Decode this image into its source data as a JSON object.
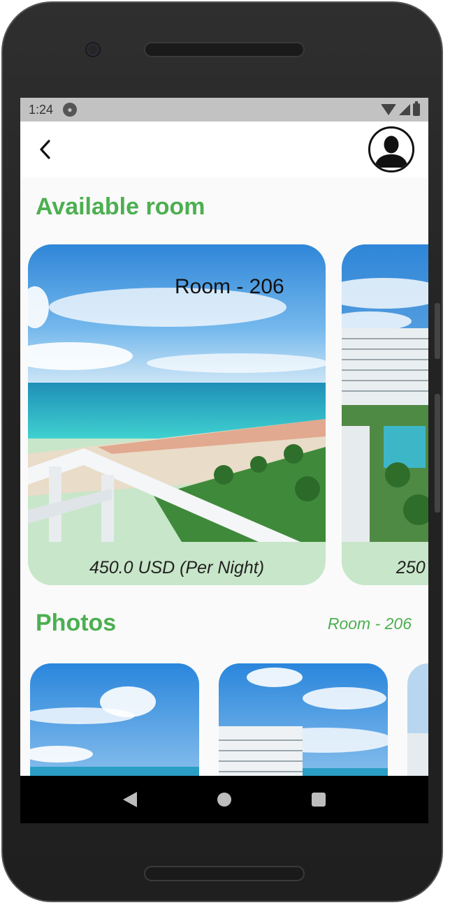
{
  "status_bar": {
    "time": "1:24"
  },
  "header": {
    "back_icon": "chevron-left-icon",
    "avatar_icon": "user-silhouette-icon"
  },
  "available_section": {
    "title": "Available room",
    "rooms": [
      {
        "name": "Room - 206",
        "price": "450.0 USD (Per Night)",
        "image": "beach-balcony-view"
      },
      {
        "name": "",
        "price": "250",
        "image": "hotel-building-pool"
      }
    ]
  },
  "photos_section": {
    "title": "Photos",
    "room_label": "Room - 206",
    "thumbnails": [
      "beach-sky-clouds",
      "hotel-building-sky",
      "hotel-building-partial"
    ]
  },
  "nav_bar": {
    "back": "nav-back-icon",
    "home": "nav-home-icon",
    "recents": "nav-recents-icon"
  },
  "colors": {
    "accent_green": "#4caf50",
    "card_bg": "#c8e6c9",
    "status_bar": "#c2c2c2"
  }
}
